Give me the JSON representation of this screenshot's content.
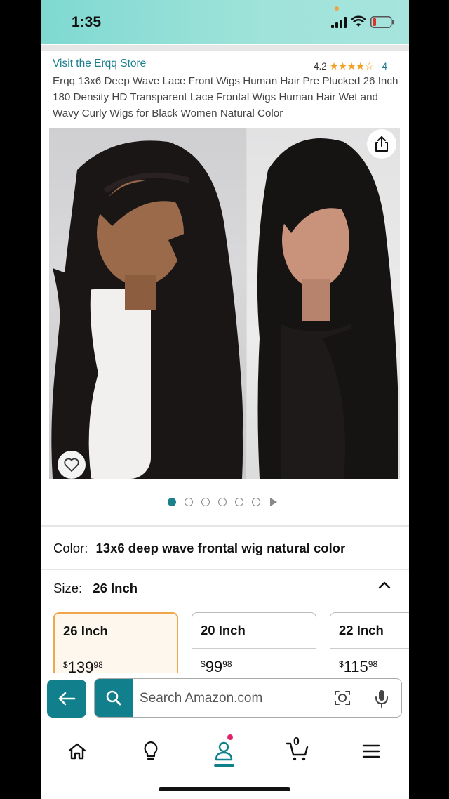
{
  "status_bar": {
    "time": "1:35"
  },
  "product": {
    "store_link": "Visit the Erqq Store",
    "rating_value": "4.2",
    "rating_stars": "★★★★☆",
    "rating_count": "4",
    "title": "Erqq 13x6 Deep Wave Lace Front Wigs Human Hair Pre Plucked 26 Inch 180 Density HD Transparent Lace Frontal Wigs Human Hair Wet and Wavy Curly Wigs for Black Women Natural Color"
  },
  "gallery": {
    "dot_count": 6,
    "active_dot": 1
  },
  "color": {
    "label": "Color:",
    "value": "13x6 deep wave frontal wig natural color"
  },
  "size": {
    "label": "Size:",
    "value": "26 Inch",
    "options": [
      {
        "name": "26 Inch",
        "currency": "$",
        "dollars": "139",
        "cents": "98",
        "selected": true
      },
      {
        "name": "20 Inch",
        "currency": "$",
        "dollars": "99",
        "cents": "98",
        "selected": false
      },
      {
        "name": "22 Inch",
        "currency": "$",
        "dollars": "115",
        "cents": "98",
        "selected": false
      }
    ]
  },
  "search": {
    "placeholder": "Search Amazon.com"
  },
  "tabbar": {
    "cart_count": "0"
  },
  "colors": {
    "accent": "#11808c",
    "link": "#1b7f8c",
    "star": "#f2a020",
    "selected_border": "#f0a64a"
  },
  "icons": [
    "share-icon",
    "heart-icon",
    "back-arrow-icon",
    "search-icon",
    "camera-icon",
    "mic-icon",
    "home-icon",
    "bulb-icon",
    "account-icon",
    "cart-icon",
    "menu-icon"
  ]
}
